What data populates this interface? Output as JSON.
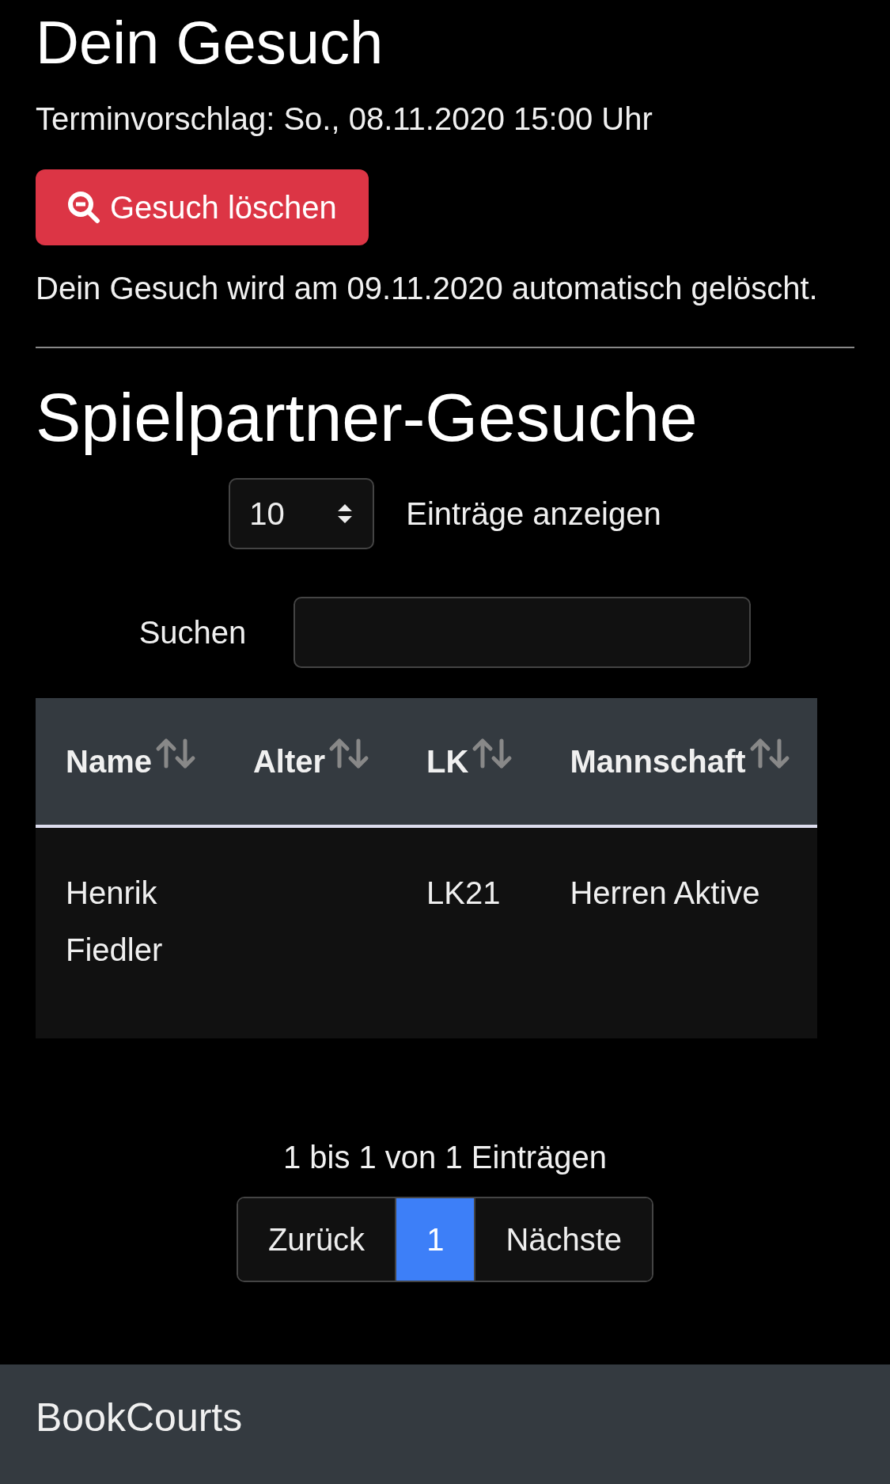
{
  "title": "Dein Gesuch",
  "proposal": "Terminvorschlag: So., 08.11.2020 15:00 Uhr",
  "delete_button": "Gesuch löschen",
  "notice": "Dein Gesuch wird am 09.11.2020 automatisch gelöscht.",
  "section_title": "Spielpartner-Gesuche",
  "length": {
    "value": "10",
    "label": "Einträge anzeigen"
  },
  "search": {
    "label": "Suchen"
  },
  "table": {
    "columns": [
      "Name",
      "Alter",
      "LK",
      "Mannschaft"
    ],
    "rows": [
      [
        "Henrik Fiedler",
        "",
        "LK21",
        "Herren Aktive"
      ]
    ]
  },
  "info": "1 bis 1 von 1 Einträgen",
  "pagination": [
    {
      "label": "Zurück",
      "selected": false
    },
    {
      "label": "1",
      "selected": true
    },
    {
      "label": "Nächste",
      "selected": false
    }
  ],
  "footer": {
    "brand": "BookCourts"
  }
}
